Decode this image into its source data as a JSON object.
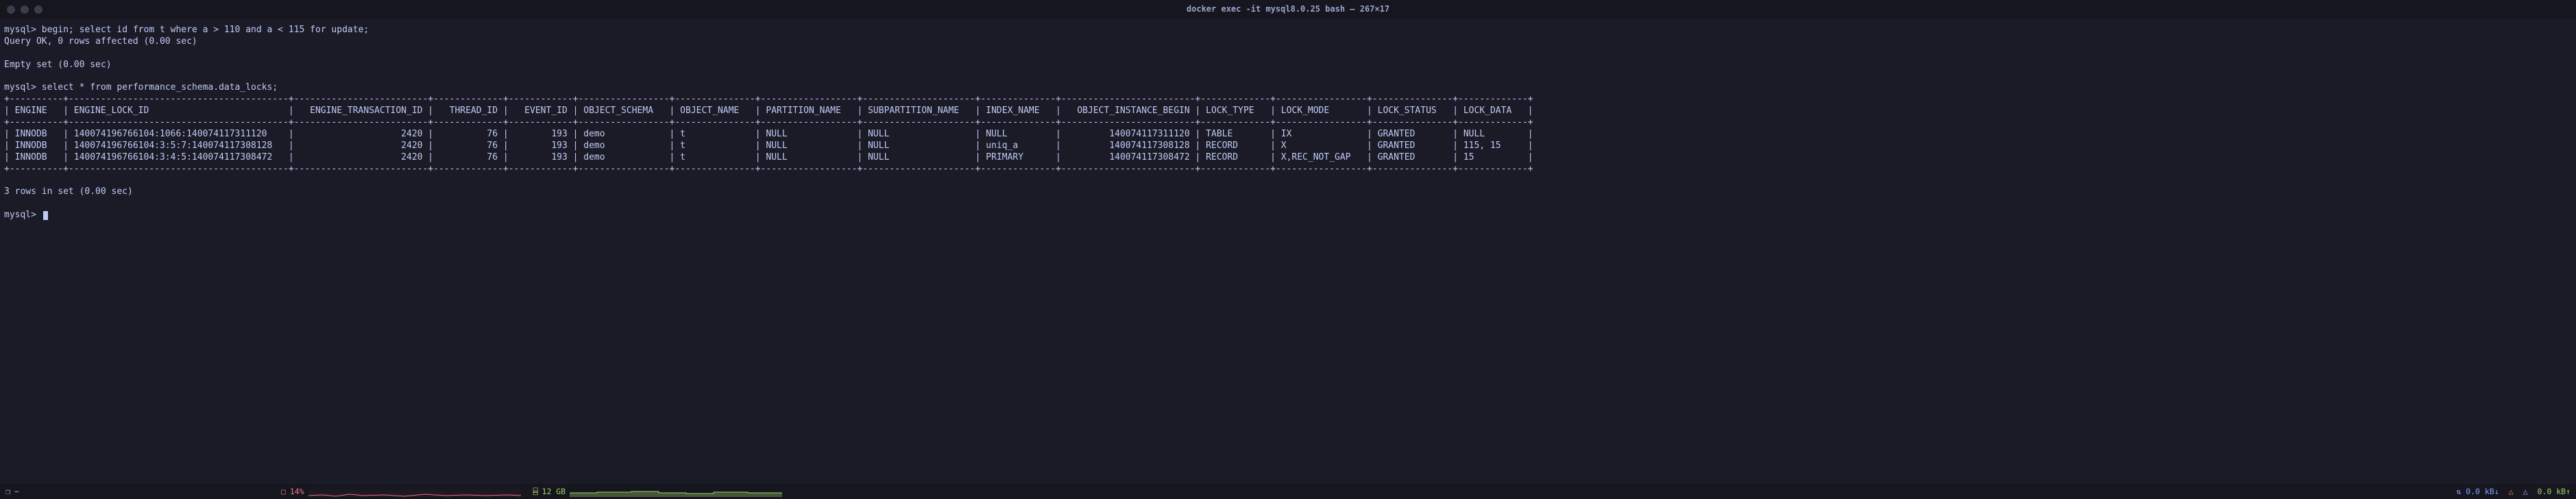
{
  "window": {
    "title": "docker exec -it mysql8.0.25 bash — 267×17"
  },
  "session": {
    "prompt": "mysql>",
    "query1": "begin; select id from t where a > 110 and a < 115 for update;",
    "result1_line1": "Query OK, 0 rows affected (0.00 sec)",
    "result1_line2": "Empty set (0.00 sec)",
    "query2": "select * from performance_schema.data_locks;",
    "footer": "3 rows in set (0.00 sec)"
  },
  "table": {
    "headers": [
      "ENGINE",
      "ENGINE_LOCK_ID",
      "ENGINE_TRANSACTION_ID",
      "THREAD_ID",
      "EVENT_ID",
      "OBJECT_SCHEMA",
      "OBJECT_NAME",
      "PARTITION_NAME",
      "SUBPARTITION_NAME",
      "INDEX_NAME",
      "OBJECT_INSTANCE_BEGIN",
      "LOCK_TYPE",
      "LOCK_MODE",
      "LOCK_STATUS",
      "LOCK_DATA"
    ],
    "rows": [
      [
        "INNODB",
        "140074196766104:1066:140074117311120",
        "2420",
        "76",
        "193",
        "demo",
        "t",
        "NULL",
        "NULL",
        "NULL",
        "140074117311120",
        "TABLE",
        "IX",
        "GRANTED",
        "NULL"
      ],
      [
        "INNODB",
        "140074196766104:3:5:7:140074117308128",
        "2420",
        "76",
        "193",
        "demo",
        "t",
        "NULL",
        "NULL",
        "uniq_a",
        "140074117308128",
        "RECORD",
        "X",
        "GRANTED",
        "115, 15"
      ],
      [
        "INNODB",
        "140074196766104:3:4:5:140074117308472",
        "2420",
        "76",
        "193",
        "demo",
        "t",
        "NULL",
        "NULL",
        "PRIMARY",
        "140074117308472",
        "RECORD",
        "X,REC_NOT_GAP",
        "GRANTED",
        "15"
      ]
    ]
  },
  "statusbar": {
    "left_icon": "❐",
    "left_text": "~",
    "cpu_icon": "▢",
    "cpu_value": "14%",
    "mem_icon": "⌸",
    "mem_value": "12 GB",
    "net_icon": "⇅",
    "net_down": "0.0 kB↓",
    "net_up": "0.0 kB↑",
    "tri": "△"
  }
}
